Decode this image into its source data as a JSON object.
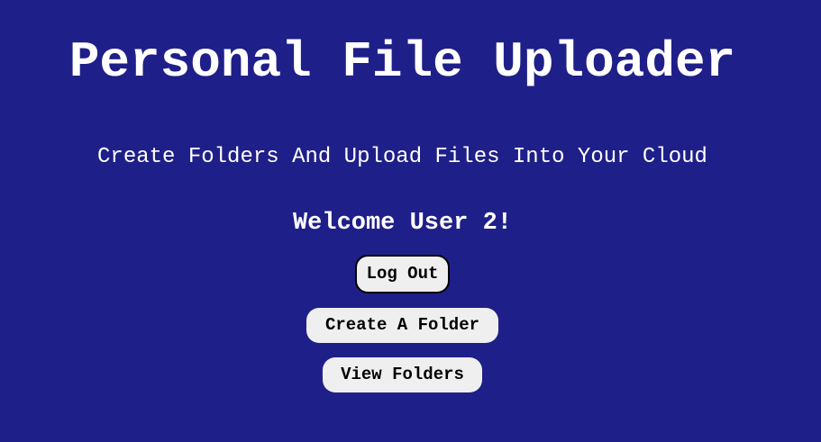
{
  "page": {
    "title": "Personal File Uploader",
    "subtitle": "Create Folders And Upload Files Into Your Cloud",
    "welcome": "Welcome User 2!"
  },
  "actions": {
    "logout_label": "Log Out",
    "create_folder_label": "Create A Folder",
    "view_folders_label": "View Folders"
  },
  "colors": {
    "background": "#1f1f8a",
    "text": "#ffffff",
    "button_bg": "#efefef",
    "button_text": "#000000"
  }
}
